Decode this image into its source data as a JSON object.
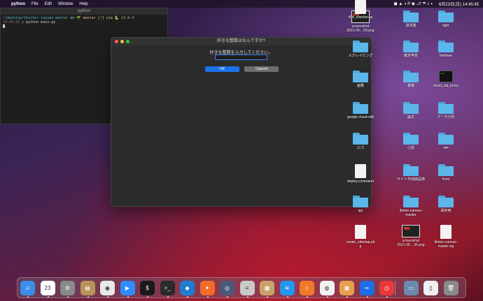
{
  "menubar": {
    "apple": "",
    "app_name": "python",
    "items": [
      "File",
      "Edit",
      "Window",
      "Help"
    ],
    "clock": "6月23日(日) 14:45:45"
  },
  "terminal": {
    "title": "python",
    "path": "~/desktop/tkinter-canvas-master",
    "on": "on",
    "branch": "master [!]",
    "via": "via",
    "python_version": "v3.9.4",
    "time": "14:45:38",
    "command": "python main.py"
  },
  "dialog": {
    "title": "好きな整数はなんですか?",
    "prompt": "好きな整数を入力してください。",
    "entry_value": "",
    "ok_label": "OK",
    "cancel_label": "Cancel"
  },
  "desktop": {
    "icons": [
      {
        "label": "screenshot\n2021-05....59.png",
        "kind": "screenshot"
      },
      {
        "label": "請求書",
        "kind": "folder"
      },
      {
        "label": "light",
        "kind": "folder"
      },
      {
        "label": "スクレイピング",
        "kind": "folder"
      },
      {
        "label": "確定申告",
        "kind": "folder"
      },
      {
        "label": "firebase",
        "kind": "folder"
      },
      {
        "label": "画像",
        "kind": "folder"
      },
      {
        "label": "書籍",
        "kind": "folder"
      },
      {
        "label": "cloud_sql_proxy",
        "kind": "exec"
      },
      {
        "label": "google-cloud-sdk",
        "kind": "folder"
      },
      {
        "label": "論文",
        "kind": "folder"
      },
      {
        "label": "データ分析",
        "kind": "folder"
      },
      {
        "label": "ロゴ",
        "kind": "folder"
      },
      {
        "label": "小説",
        "kind": "folder"
      },
      {
        "label": "site",
        "kind": "folder"
      },
      {
        "label": "deploy.command",
        "kind": "doc"
      },
      {
        "label": "サイト作成納品物",
        "kind": "folder"
      },
      {
        "label": "front",
        "kind": "folder"
      },
      {
        "label": "api",
        "kind": "folder"
      },
      {
        "label": "tkinter-canvas-\nmaster",
        "kind": "folder"
      },
      {
        "label": "保存用",
        "kind": "folder"
      },
      {
        "label": "create_sitemap.ph\np",
        "kind": "doc"
      },
      {
        "label": "screenshot\n2021-05....35.png",
        "kind": "screenshot"
      },
      {
        "label": "tkinter-canvas-\nmaster.zip",
        "kind": "zip"
      },
      {
        "label": "404_checker.py",
        "kind": "doc"
      }
    ]
  },
  "dock": {
    "apps": [
      {
        "name": "finder-icon",
        "color": "#3a8ee6",
        "glyph": "☺"
      },
      {
        "name": "calendar-icon",
        "color": "#ffffff",
        "glyph": "23"
      },
      {
        "name": "system-preferences-icon",
        "color": "#8a8a8a",
        "glyph": "⚙"
      },
      {
        "name": "notes-app-icon",
        "color": "#b8935a",
        "glyph": "▤"
      },
      {
        "name": "chrome-icon",
        "color": "#e8e8e8",
        "glyph": "◉"
      },
      {
        "name": "zoom-icon",
        "color": "#2d8cff",
        "glyph": "▶"
      },
      {
        "name": "terminal-green-icon",
        "color": "#1a1a1a",
        "glyph": "$"
      },
      {
        "name": "terminal-icon",
        "color": "#2a2a2a",
        "glyph": ">_"
      },
      {
        "name": "vscode-icon",
        "color": "#1f7dd1",
        "glyph": "◆"
      },
      {
        "name": "safari-icon",
        "color": "#f06a2a",
        "glyph": "✦"
      },
      {
        "name": "quicktime-icon",
        "color": "#4a5a7a",
        "glyph": "◎"
      },
      {
        "name": "database-icon",
        "color": "#c9c9c9",
        "glyph": "≡"
      },
      {
        "name": "archive-icon",
        "color": "#c9a26a",
        "glyph": "▦"
      },
      {
        "name": "docker-icon",
        "color": "#2496ed",
        "glyph": "≋"
      },
      {
        "name": "sourcetree-icon",
        "color": "#f07a2a",
        "glyph": "⑂"
      },
      {
        "name": "postgres-icon",
        "color": "#f2f2f2",
        "glyph": "◍"
      },
      {
        "name": "preview-icon",
        "color": "#e8a050",
        "glyph": "▣"
      },
      {
        "name": "infinity-app-icon",
        "color": "#1a6ee8",
        "glyph": "∞"
      },
      {
        "name": "clock-icon",
        "color": "#e83a3a",
        "glyph": "◷"
      },
      {
        "name": "photos-folder-icon",
        "color": "#6a8ab0",
        "glyph": "▭"
      },
      {
        "name": "document-icon",
        "color": "#f0f0f0",
        "glyph": "▯"
      },
      {
        "name": "trash-icon",
        "color": "#8a8a8a",
        "glyph": "🗑"
      }
    ]
  }
}
